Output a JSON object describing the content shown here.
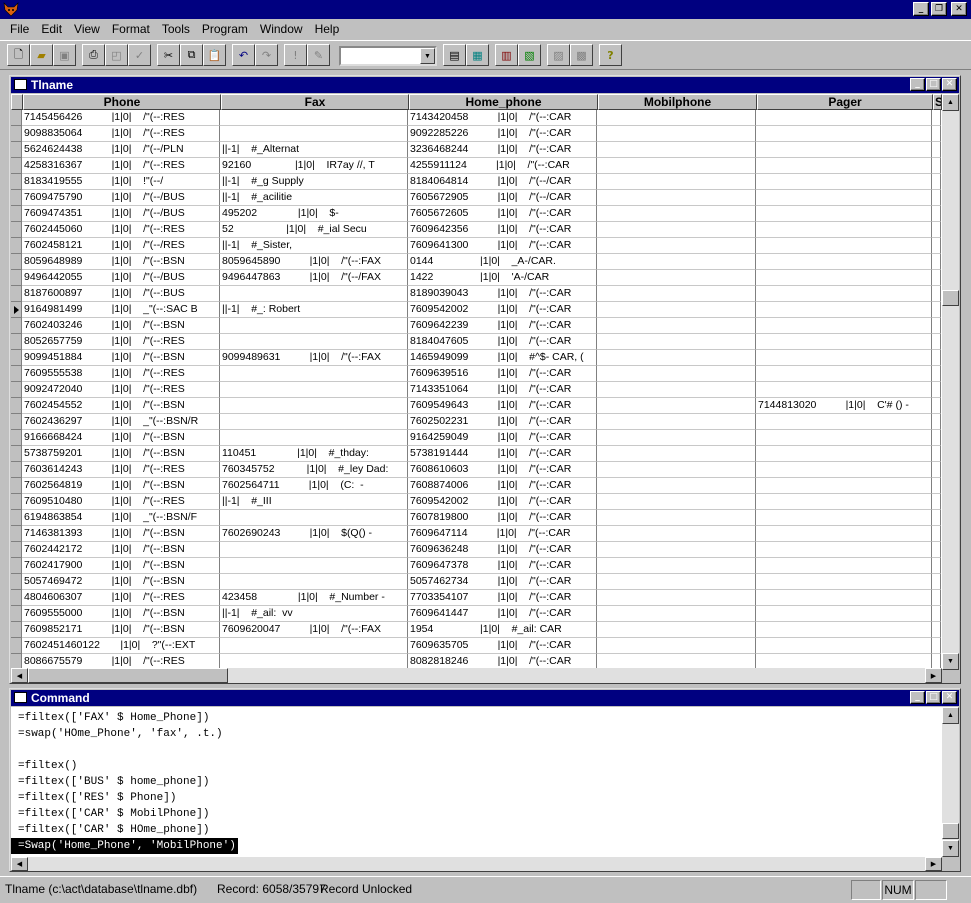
{
  "menu": [
    "File",
    "Edit",
    "View",
    "Format",
    "Tools",
    "Program",
    "Window",
    "Help"
  ],
  "toolbar_icons": [
    "new-icon",
    "open-icon",
    "save-icon",
    "print-icon",
    "print-preview-icon",
    "spell-check-icon",
    "cut-icon",
    "copy-icon",
    "paste-icon",
    "undo-icon",
    "redo-icon",
    "run-icon",
    "modify-icon",
    "form-design-icon",
    "browse-icon",
    "report-icon",
    "label-icon",
    "query-icon",
    "program-icon",
    "help-icon"
  ],
  "browse": {
    "title": "Tlname",
    "columns": [
      "Phone",
      "Fax",
      "Home_phone",
      "Mobilphone",
      "Pager",
      "S"
    ],
    "current_row": 12,
    "rows": [
      [
        "7145456426          |1|0|    /\"(--:RES",
        "",
        "7143420458          |1|0|    /\"(--:CAR",
        "",
        ""
      ],
      [
        "9098835064          |1|0|    /\"(--:RES",
        "",
        "9092285226          |1|0|    /\"(--:CAR",
        "",
        ""
      ],
      [
        "5624624438          |1|0|    /\"(--/PLN",
        "||-1|    #_Alternat",
        "3236468244          |1|0|    /\"(--:CAR",
        "",
        ""
      ],
      [
        "4258316367          |1|0|    /\"(--:RES",
        "92160               |1|0|    IR7ay //, T",
        "4255911124          |1|0|    /\"(--:CAR",
        "",
        ""
      ],
      [
        "8183419555          |1|0|    !\"(--/",
        "||-1|    #_g Supply",
        "8184064814          |1|0|    /\"(--/CAR",
        "",
        ""
      ],
      [
        "7609475790          |1|0|    /\"(--/BUS",
        "||-1|    #_acilitie",
        "7605672905          |1|0|    /\"(--/CAR",
        "",
        ""
      ],
      [
        "7609474351          |1|0|    /\"(--/BUS",
        "495202              |1|0|    $-",
        "7605672605          |1|0|    /\"(--:CAR",
        "",
        ""
      ],
      [
        "7602445060          |1|0|    /\"(--:RES",
        "52                  |1|0|    #_ial Secu",
        "7609642356          |1|0|    /\"(--:CAR",
        "",
        ""
      ],
      [
        "7602458121          |1|0|    /\"(--/RES",
        "||-1|    #_Sister,",
        "7609641300          |1|0|    /\"(--:CAR",
        "",
        ""
      ],
      [
        "8059648989          |1|0|    /\"(--:BSN",
        "8059645890          |1|0|    /\"(--:FAX",
        "0144                |1|0|    _A-/CAR.",
        "",
        ""
      ],
      [
        "9496442055          |1|0|    /\"(--/BUS",
        "9496447863          |1|0|    /\"(--/FAX",
        "1422                |1|0|    'A-/CAR",
        "",
        ""
      ],
      [
        "8187600897          |1|0|    /\"(--:BUS",
        "",
        "8189039043          |1|0|    /\"(--:CAR",
        "",
        ""
      ],
      [
        "9164981499          |1|0|    _\"(--:SAC B",
        "||-1|    #_: Robert",
        "7609542002          |1|0|    /\"(--:CAR",
        "",
        ""
      ],
      [
        "7602403246          |1|0|    /\"(--:BSN",
        "",
        "7609642239          |1|0|    /\"(--:CAR",
        "",
        ""
      ],
      [
        "8052657759          |1|0|    /\"(--:RES",
        "",
        "8184047605          |1|0|    /\"(--:CAR",
        "",
        ""
      ],
      [
        "9099451884          |1|0|    /\"(--:BSN",
        "9099489631          |1|0|    /\"(--:FAX",
        "1465949099          |1|0|    #^$- CAR, (",
        "",
        ""
      ],
      [
        "7609555538          |1|0|    /\"(--:RES",
        "",
        "7609639516          |1|0|    /\"(--:CAR",
        "",
        ""
      ],
      [
        "9092472040          |1|0|    /\"(--:RES",
        "",
        "7143351064          |1|0|    /\"(--:CAR",
        "",
        ""
      ],
      [
        "7602454552          |1|0|    /\"(--:BSN",
        "",
        "7609549643          |1|0|    /\"(--:CAR",
        "",
        "7144813020          |1|0|    C'# () -"
      ],
      [
        "7602436297          |1|0|    _\"(--:BSN/R",
        "",
        "7602502231          |1|0|    /\"(--:CAR",
        "",
        ""
      ],
      [
        "9166668424          |1|0|    /\"(--:BSN",
        "",
        "9164259049          |1|0|    /\"(--:CAR",
        "",
        ""
      ],
      [
        "5738759201          |1|0|    /\"(--:BSN",
        "110451              |1|0|    #_thday:",
        "5738191444          |1|0|    /\"(--:CAR",
        "",
        ""
      ],
      [
        "7603614243          |1|0|    /\"(--:RES",
        "760345752           |1|0|    #_ley Dad:",
        "7608610603          |1|0|    /\"(--:CAR",
        "",
        ""
      ],
      [
        "7602564819          |1|0|    /\"(--:BSN",
        "7602564711          |1|0|    (C:  -",
        "7608874006          |1|0|    /\"(--:CAR",
        "",
        ""
      ],
      [
        "7609510480          |1|0|    /\"(--:RES",
        "||-1|    #_III",
        "7609542002          |1|0|    /\"(--:CAR",
        "",
        ""
      ],
      [
        "6194863854          |1|0|    _\"(--:BSN/F",
        "",
        "7607819800          |1|0|    /\"(--:CAR",
        "",
        ""
      ],
      [
        "7146381393          |1|0|    /\"(--:BSN",
        "7602690243          |1|0|    $(Q() -",
        "7609647114          |1|0|    /\"(--:CAR",
        "",
        ""
      ],
      [
        "7602442172          |1|0|    /\"(--:BSN",
        "",
        "7609636248          |1|0|    /\"(--:CAR",
        "",
        ""
      ],
      [
        "7602417900          |1|0|    /\"(--:BSN",
        "",
        "7609647378          |1|0|    /\"(--:CAR",
        "",
        ""
      ],
      [
        "5057469472          |1|0|    /\"(--:BSN",
        "",
        "5057462734          |1|0|    /\"(--:CAR",
        "",
        ""
      ],
      [
        "4804606307          |1|0|    /\"(--:RES",
        "423458              |1|0|    #_Number -",
        "7703354107          |1|0|    /\"(--:CAR",
        "",
        ""
      ],
      [
        "7609555000          |1|0|    /\"(--:BSN",
        "||-1|    #_ail:  vv",
        "7609641447          |1|0|    /\"(--:CAR",
        "",
        ""
      ],
      [
        "7609852171          |1|0|    /\"(--:BSN",
        "7609620047          |1|0|    /\"(--:FAX",
        "1954                |1|0|    #_ail: CAR",
        "",
        ""
      ],
      [
        "7602451460122       |1|0|    ?\"(--:EXT",
        "",
        "7609635705          |1|0|    /\"(--:CAR",
        "",
        ""
      ],
      [
        "8086675579          |1|0|    /\"(--:RES",
        "",
        "8082818246          |1|0|    /\"(--:CAR",
        "",
        ""
      ]
    ]
  },
  "command": {
    "title": "Command",
    "lines": [
      "=filtex(['FAX' $ Home_Phone])",
      "=swap('HOme_Phone', 'fax', .t.)",
      "",
      "=filtex()",
      "=filtex(['BUS' $ home_phone])",
      "=filtex(['RES' $ Phone])",
      "=filtex(['CAR' $ MobilPhone])",
      "=filtex(['CAR' $ HOme_phone])",
      "=Swap('Home_Phone', 'MobilPhone')"
    ]
  },
  "status": {
    "file": "Tlname (c:\\act\\database\\tlname.dbf)",
    "record": "Record: 6058/35797",
    "lock": "Record Unlocked",
    "num": "NUM"
  },
  "colors": {
    "title_bar": "#000080",
    "face": "#c0c0c0"
  }
}
